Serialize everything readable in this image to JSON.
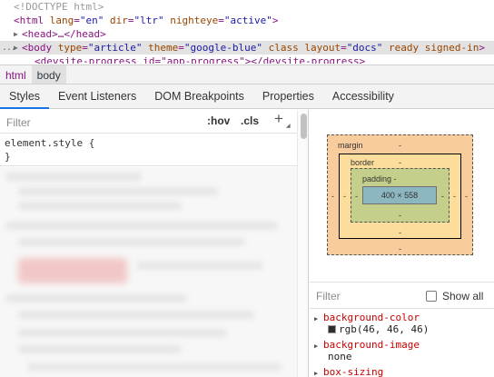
{
  "dom_tree": {
    "doctype": "<!DOCTYPE html>",
    "html_open": {
      "tag": "html",
      "attrs": [
        [
          "lang",
          "\"en\""
        ],
        [
          "dir",
          "\"ltr\""
        ],
        [
          "nighteye",
          "\"active\""
        ]
      ]
    },
    "head_line": "<head>…</head>",
    "body_line": {
      "tag": "body",
      "attrs": [
        [
          "type",
          "\"article\""
        ],
        [
          "theme",
          "\"google-blue\""
        ],
        [
          "class",
          ""
        ],
        [
          "layout",
          "\"docs\""
        ],
        [
          "ready",
          ""
        ],
        [
          "signed-in",
          ""
        ]
      ]
    },
    "partial_line": "<devsite-progress id=\"app-progress\"></devsite-progress>",
    "ellipsis": "..."
  },
  "breadcrumbs": [
    "html",
    "body"
  ],
  "tabs": [
    "Styles",
    "Event Listeners",
    "DOM Breakpoints",
    "Properties",
    "Accessibility"
  ],
  "styles_pane": {
    "filter_placeholder": "Filter",
    "hov_label": ":hov",
    "cls_label": ".cls",
    "add_label": "+",
    "element_style_open": "element.style {",
    "element_style_close": "}"
  },
  "box_model": {
    "margin_label": "margin",
    "border_label": "border",
    "padding_label": "padding -",
    "content_size": "400 × 558",
    "dash": "-"
  },
  "computed": {
    "filter_placeholder": "Filter",
    "show_all_label": "Show all",
    "properties": [
      {
        "name": "background-color",
        "value": "rgb(46, 46, 46)",
        "swatch": "#2e2e2e"
      },
      {
        "name": "background-image",
        "value": "none"
      },
      {
        "name": "box-sizing",
        "value": ""
      }
    ]
  },
  "colors": {
    "margin": "#f9cc9d",
    "border": "#fddd9b",
    "padding": "#c3cf8a",
    "content": "#8cb6c0",
    "active_tab": "#1a73e8"
  }
}
